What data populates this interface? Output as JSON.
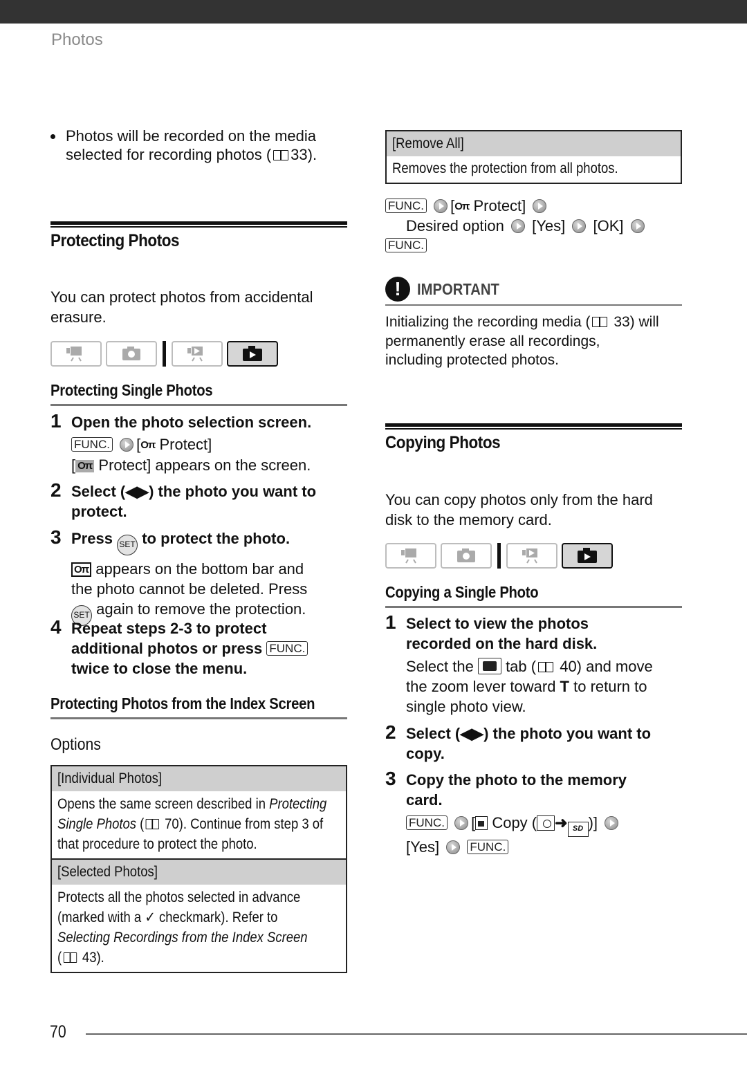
{
  "header": {
    "section": "Photos"
  },
  "left": {
    "bullet": "Photos will be recorded on the media selected for recording photos (",
    "bullet_ref": "33).",
    "section_title": "Protecting Photos",
    "intro": "You can protect photos from accidental erasure.",
    "mode_buttons": [
      {
        "name": "movie-record-mode",
        "active": false
      },
      {
        "name": "photo-record-mode",
        "active": false
      },
      {
        "name": "movie-playback-mode",
        "active": false
      },
      {
        "name": "photo-playback-mode",
        "active": true
      }
    ],
    "single_title": "Protecting Single Photos",
    "steps": [
      {
        "num": "1",
        "title": "Open the photo selection screen.",
        "func": "FUNC.",
        "menu": "[",
        "menu_item": " Protect]",
        "note_pre": "[",
        "note_post": " Protect] appears on the screen."
      },
      {
        "num": "2",
        "title_l1": "Select (◀▶) the photo you want to",
        "title_l2": "protect."
      },
      {
        "num": "3",
        "title_pre": "Press",
        "set": "SET",
        "title_post": "to protect the photo.",
        "body_l1": " appears on the bottom bar and",
        "body_l2": "the photo cannot be deleted. Press",
        "body_l3": " again to remove the protection."
      },
      {
        "num": "4",
        "title_l1": "Repeat steps 2-3 to protect",
        "title_l2": "additional photos or press",
        "func": "FUNC.",
        "title_l3": "twice to close the menu."
      }
    ],
    "index_title": "Protecting Photos from the Index Screen",
    "options_label": "Options",
    "options": [
      {
        "head": "[Individual Photos]",
        "l1_pre": "Opens the same screen described in ",
        "l1_it": "Protecting",
        "l2_it": "Single Photos",
        "l2_pre": " (",
        "l2_post": " 70). Continue from step 3 of",
        "l3": "that procedure to protect the photo."
      },
      {
        "head": "[Selected Photos]",
        "l1": "Protects all the photos selected in advance",
        "l2_pre": "(marked with a ",
        "check": "✓",
        "l2_post": " checkmark). Refer to",
        "l3_it": "Selecting Recordings from the Index Screen",
        "l4_pre": "(",
        "l4_post": " 43)."
      }
    ]
  },
  "right": {
    "remove_all": {
      "head": "[Remove All]",
      "body": "Removes the protection from all photos."
    },
    "procedure": {
      "func": "FUNC.",
      "open": "[",
      "protect": " Protect]",
      "desired": "Desired option",
      "yes": "[Yes]",
      "ok": "[OK]",
      "func2": "FUNC."
    },
    "important": {
      "label": "IMPORTANT",
      "l1_pre": "Initializing the recording media (",
      "l1_post": " 33) will",
      "l2": "permanently erase all recordings,",
      "l3": "including protected photos."
    },
    "section_title": "Copying Photos",
    "intro_l1": "You can copy photos only from the hard",
    "intro_l2": "disk to the memory card.",
    "single_title": "Copying a Single Photo",
    "steps": [
      {
        "num": "1",
        "title_l1": "Select to view the photos",
        "title_l2": "recorded on the hard disk.",
        "body_l1_pre": "Select the ",
        "body_l1_mid": " tab (",
        "body_l1_post": " 40) and move",
        "body_l2_pre": "the zoom lever toward ",
        "body_l2_bold": "T",
        "body_l2_post": " to return to",
        "body_l3": "single photo view."
      },
      {
        "num": "2",
        "title_l1": "Select (◀▶) the photo you want to",
        "title_l2": "copy."
      },
      {
        "num": "3",
        "title_l1": "Copy the photo to the memory",
        "title_l2": "card.",
        "func": "FUNC.",
        "copy_pre": "[",
        "copy_label": " Copy (",
        "copy_post": ")]",
        "yes": "[Yes]",
        "func2": "FUNC.",
        "sd": "SD"
      }
    ]
  },
  "footer": {
    "page_number": "70"
  }
}
